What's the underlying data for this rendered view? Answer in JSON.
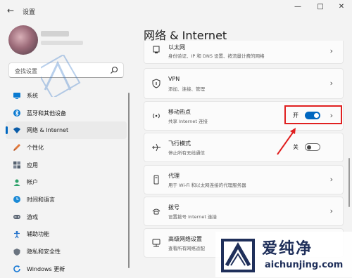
{
  "window": {
    "title": "设置",
    "controls": [
      "minimize",
      "maximize",
      "close"
    ]
  },
  "search": {
    "placeholder": "查找设置"
  },
  "sidebar": {
    "items": [
      {
        "label": "系统",
        "icon": "monitor-icon",
        "color": "#0a7ad1"
      },
      {
        "label": "蓝牙和其他设备",
        "icon": "bluetooth-icon",
        "color": "#0a7ad1"
      },
      {
        "label": "网络 & Internet",
        "icon": "wifi-icon",
        "color": "#0a5ca8",
        "active": true
      },
      {
        "label": "个性化",
        "icon": "brush-icon",
        "color": "#e0773a"
      },
      {
        "label": "应用",
        "icon": "apps-icon",
        "color": "#54606e"
      },
      {
        "label": "帐户",
        "icon": "person-icon",
        "color": "#2fa36b"
      },
      {
        "label": "时间和语言",
        "icon": "globe-clock-icon",
        "color": "#1b8ad6"
      },
      {
        "label": "游戏",
        "icon": "gamepad-icon",
        "color": "#5a6472"
      },
      {
        "label": "辅助功能",
        "icon": "accessibility-icon",
        "color": "#1e6fc9"
      },
      {
        "label": "隐私和安全性",
        "icon": "shield-icon",
        "color": "#6b7480"
      },
      {
        "label": "Windows 更新",
        "icon": "update-icon",
        "color": "#1b7bd6"
      }
    ]
  },
  "main": {
    "title": "网络 & Internet",
    "cards": [
      {
        "title": "以太网",
        "subtitle": "身份验证、IP 和 DNS 设置、按流量计费的网络",
        "icon": "ethernet-icon"
      },
      {
        "title": "VPN",
        "subtitle": "添加、连接、管理",
        "icon": "vpn-shield-icon"
      },
      {
        "title": "移动热点",
        "subtitle": "共享 Internet 连接",
        "icon": "hotspot-icon",
        "toggle": "on",
        "state_label": "开"
      },
      {
        "title": "飞行模式",
        "subtitle": "停止所有无线通信",
        "icon": "airplane-icon",
        "toggle": "off",
        "state_label": "关"
      },
      {
        "title": "代理",
        "subtitle": "用于 Wi-Fi 和以太网连接的代理服务器",
        "icon": "proxy-icon"
      },
      {
        "title": "拨号",
        "subtitle": "设置拨号 Internet 连接",
        "icon": "dialup-icon"
      },
      {
        "title": "高级网络设置",
        "subtitle": "查看所有网络适配",
        "icon": "network-adapter-icon"
      }
    ]
  },
  "watermark": {
    "brand_cn": "爱纯净",
    "url": "aichunjing.com",
    "accent": "#1f2f5a"
  },
  "annotation": {
    "color": "#e02020"
  },
  "accent_color": "#0067c0"
}
